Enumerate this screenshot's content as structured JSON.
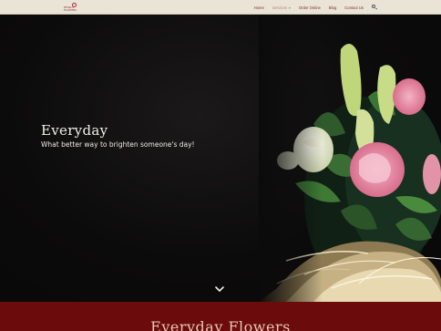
{
  "brand": {
    "logo_line1": "PETALS",
    "logo_line2": "FLOWERS"
  },
  "nav": {
    "items": [
      {
        "label": "Home"
      },
      {
        "label": "Services"
      },
      {
        "label": "Order Online"
      },
      {
        "label": "Blog"
      },
      {
        "label": "Contact Us"
      }
    ],
    "active_index": 1,
    "search_icon": "search-icon"
  },
  "hero": {
    "title": "Everyday",
    "subtitle": "What better way to brighten someone's day!",
    "scroll_icon": "chevron-down-icon"
  },
  "section": {
    "title": "Everyday Flowers"
  },
  "colors": {
    "topbar": "#e9e4d6",
    "nav_text": "#7d2d35",
    "hero_bg": "#0c0b0b",
    "band_bg": "#6c0b0b",
    "band_title": "#e8c9b7"
  }
}
